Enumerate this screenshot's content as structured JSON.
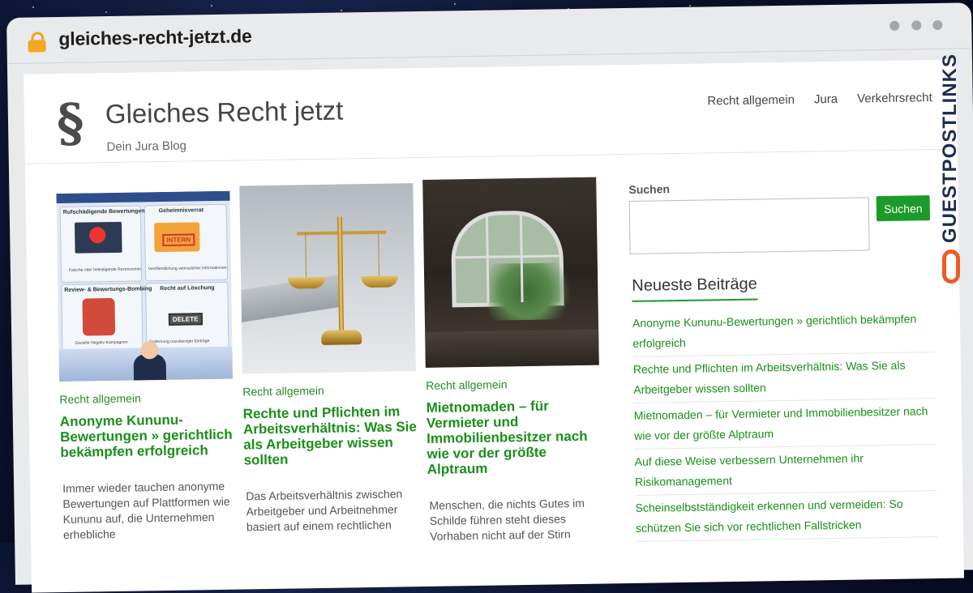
{
  "browser": {
    "url": "gleiches-recht-jetzt.de"
  },
  "site": {
    "logo_symbol": "§",
    "title": "Gleiches Recht jetzt",
    "tagline": "Dein Jura Blog",
    "nav": [
      "Recht allgemein",
      "Jura",
      "Verkehrsrecht"
    ]
  },
  "posts": [
    {
      "category": "Recht allgemein",
      "title": "Anonyme Kununu-Bewertungen » gerichtlich bekämpfen erfolgreich",
      "excerpt": "Immer wieder tauchen anonyme Bewertungen auf Plattformen wie Kununu auf, die Unternehmen erhebliche",
      "thumb": {
        "labels": [
          "Rufschädigende Bewertungen",
          "Geheimnisverrat",
          "Review- & Bewertungs-Bombing",
          "Recht auf Löschung"
        ],
        "captions": [
          "Falsche oder beleidigende Rezensionen",
          "Veröffentlichung vertraulicher Informationen",
          "Gezielte Negativ-Kampagnen",
          "Entfernung unzulässiger Einträge"
        ],
        "stamp": "INTERN",
        "delete_label": "DELETE"
      }
    },
    {
      "category": "Recht allgemein",
      "title": "Rechte und Pflichten im Arbeitsverhältnis: Was Sie als Arbeitgeber wissen sollten",
      "excerpt": "Das Arbeitsverhältnis zwischen Arbeitgeber und Arbeitnehmer basiert auf einem rechtlichen"
    },
    {
      "category": "Recht allgemein",
      "title": "Mietnomaden – für Vermieter und Immobilienbesitzer nach wie vor der größte Alptraum",
      "excerpt": "Menschen, die nichts Gutes im Schilde führen steht dieses Vorhaben nicht auf der Stirn"
    }
  ],
  "sidebar": {
    "search_label": "Suchen",
    "search_button": "Suchen",
    "recent_heading": "Neueste Beiträge",
    "recent": [
      "Anonyme Kununu-Bewertungen » gerichtlich bekämpfen erfolgreich",
      "Rechte und Pflichten im Arbeitsverhältnis: Was Sie als Arbeitgeber wissen sollten",
      "Mietnomaden – für Vermieter und Immobilienbesitzer nach wie vor der größte Alptraum",
      "Auf diese Weise verbessern Unternehmen ihr Risikomanagement",
      "Scheinselbstständigkeit erkennen und vermeiden: So schützen Sie sich vor rechtlichen Fallstricken"
    ]
  },
  "badge": {
    "text": "GUESTPOSTLINKS"
  },
  "colors": {
    "accent": "#1d9a2a",
    "link": "#1a8f1a",
    "badge_orange": "#f05a24",
    "badge_text": "#1f2d4f"
  }
}
